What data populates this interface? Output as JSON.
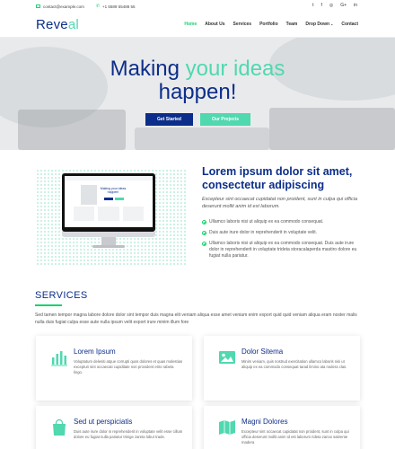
{
  "topbar": {
    "email": "contact@example.com",
    "phone": "+1 5589 55488 55",
    "social": [
      "t",
      "f",
      "◎",
      "G+",
      "in"
    ]
  },
  "brand": {
    "part1": "Reve",
    "part2": "al"
  },
  "nav": {
    "items": [
      "Home",
      "About Us",
      "Services",
      "Portfolio",
      "Team",
      "Drop Down",
      "Contact"
    ],
    "active": "Home"
  },
  "hero": {
    "line1_a": "Making ",
    "line1_b": "your ideas",
    "line2": "happen!",
    "btn_primary": "Get Started",
    "btn_secondary": "Our Projects"
  },
  "about": {
    "title": "Lorem ipsum dolor sit amet, consectetur adipiscing",
    "lead": "Excepteur sint occaecat cupidatat non proident, sunt in culpa qui officia deserunt mollit anim id est laborum.",
    "bullets": [
      "Ullamco laboris nisi ut aliquip ex ea commodo consequat.",
      "Duis aute irure dolor in reprehenderit in voluptate velit.",
      "Ullamco laboris nisi ut aliquip ex ea commodo consequat. Duis aute irure dolor in reprehenderit in voluptate trideta storacalaperda mastiro dolore eu fugiat nulla pariatur."
    ],
    "screen_title": "Making your ideas happen!"
  },
  "services": {
    "title": "SERVICES",
    "intro": "Sed tamen tempor magna labore dolore dolor sint tempor duis magna elit veniam aliqua esse amet veniam enim export quid quid veniam aliqua eram noster malis nulla duis fugiat culpa esse aute nulla ipsum velit export irure minim illum fore",
    "cards": [
      {
        "title": "Lorem Ipsum",
        "text": "Voluptatum deleniti atque corrupti quos dolores et quas molestias excepturi sint occaecati cupiditate non provident etiro rabeta lingo.",
        "icon": "bar-chart-icon"
      },
      {
        "title": "Dolor Sitema",
        "text": "Minim veniam, quis nostrud exercitation ullamco laboris nisi ut aliquip ex ea commodo consequat tarad limino ata nodera clas.",
        "icon": "picture-icon"
      },
      {
        "title": "Sed ut perspiciatis",
        "text": "Duis aute irure dolor in reprehenderit in voluptate velit esse cillum dolore eu fugiat nulla pariatur trinige zareta lobur trade.",
        "icon": "shopping-bag-icon"
      },
      {
        "title": "Magni Dolores",
        "text": "Excepteur sint occaecat cupidatat non proident, sunt in culpa qui officia deserunt mollit anim id est laborum rideta zanox satirente madera",
        "icon": "map-icon"
      }
    ]
  },
  "colors": {
    "navy": "#0c2e8a",
    "mint": "#50d8af",
    "green": "#18d26e"
  }
}
